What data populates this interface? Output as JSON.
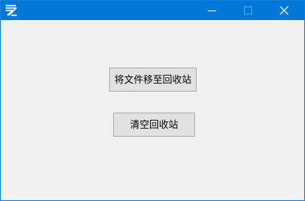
{
  "window": {
    "title": "",
    "icon": "app-logo-icon",
    "controls": {
      "minimize_icon": "minimize-icon",
      "maximize_icon": "maximize-icon",
      "close_icon": "close-icon"
    },
    "titlebar_color": "#0078d7"
  },
  "main": {
    "move_to_recycle_label": "将文件移至回收站",
    "empty_recycle_label": "清空回收站"
  }
}
